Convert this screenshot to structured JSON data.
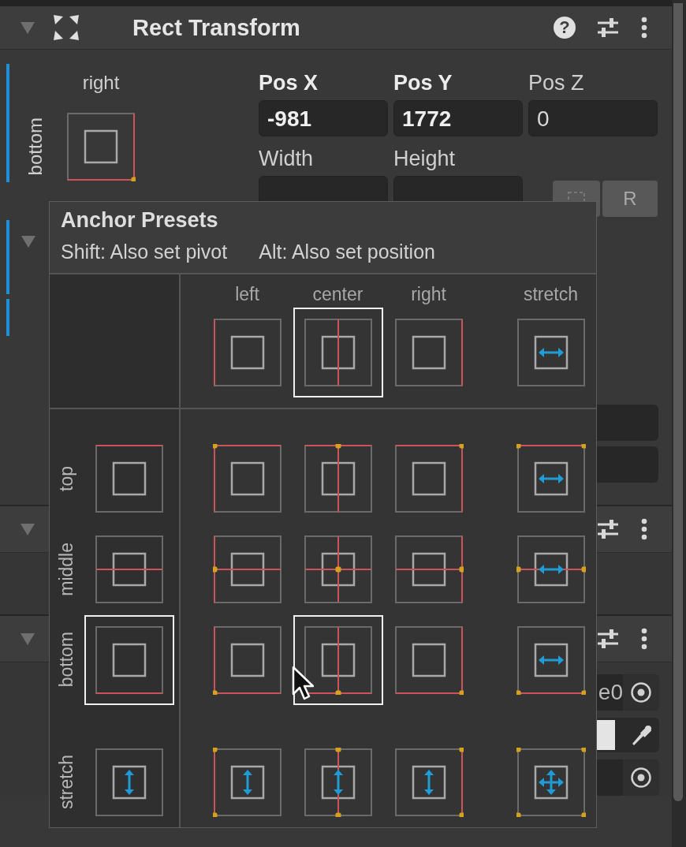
{
  "component": {
    "title": "Rect Transform",
    "expanded": true,
    "help": "?"
  },
  "anchor_widget": {
    "h_label": "right",
    "v_label": "bottom",
    "kind": "bottom_right"
  },
  "position_fields": [
    {
      "label": "Pos X",
      "value": "-981",
      "overridden": true
    },
    {
      "label": "Pos Y",
      "value": "1772",
      "overridden": true
    },
    {
      "label": "Pos Z",
      "value": "0",
      "overridden": false
    }
  ],
  "size_fields": [
    {
      "label": "Width"
    },
    {
      "label": "Height"
    }
  ],
  "buttons": [
    {
      "kind": "blueprint"
    },
    {
      "kind": "raw",
      "label": "R"
    }
  ],
  "anchors_foldout": {
    "expanded": true
  },
  "extra_fields": [
    {
      "kind": "field"
    },
    {
      "kind": "field"
    }
  ],
  "other_components": [
    {
      "expanded": true
    },
    {
      "expanded": true,
      "rows": [
        {
          "kind": "object",
          "value": "e0"
        },
        {
          "kind": "color"
        },
        {
          "kind": "object"
        }
      ]
    }
  ],
  "anchor_presets": {
    "title": "Anchor Presets",
    "hints": [
      "Shift: Also set pivot",
      "Alt: Also set position"
    ],
    "columns": [
      {
        "label": "left",
        "kind": "min",
        "selected": false
      },
      {
        "label": "center",
        "kind": "mid",
        "selected": true
      },
      {
        "label": "right",
        "kind": "max",
        "selected": false
      },
      {
        "label": "stretch",
        "kind": "fill",
        "selected": false
      }
    ],
    "rows": [
      {
        "label": "top",
        "kind": "max",
        "selected": false,
        "cells": [
          {
            "selected": false
          },
          {
            "selected": false
          },
          {
            "selected": false
          },
          {
            "selected": false
          }
        ]
      },
      {
        "label": "middle",
        "kind": "mid",
        "selected": false,
        "cells": [
          {
            "selected": false
          },
          {
            "selected": false
          },
          {
            "selected": false
          },
          {
            "selected": false
          }
        ]
      },
      {
        "label": "bottom",
        "kind": "min",
        "selected": true,
        "cells": [
          {
            "selected": false
          },
          {
            "selected": true
          },
          {
            "selected": false
          },
          {
            "selected": false
          }
        ]
      },
      {
        "label": "stretch",
        "kind": "fill",
        "selected": false,
        "cells": [
          {
            "selected": false
          },
          {
            "selected": false
          },
          {
            "selected": false
          },
          {
            "selected": false
          }
        ]
      }
    ]
  }
}
